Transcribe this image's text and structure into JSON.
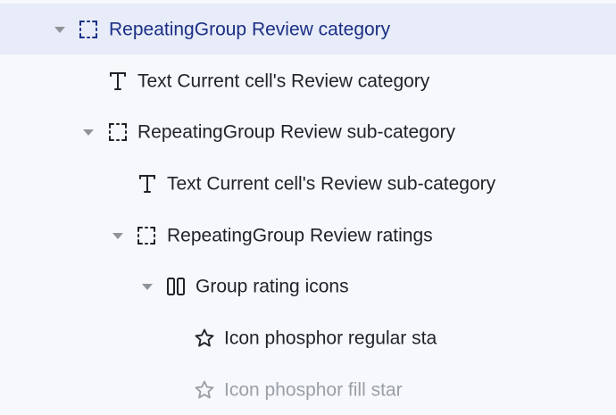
{
  "tree": {
    "items": [
      {
        "label": "RepeatingGroup Review category",
        "icon": "repeating-group-icon",
        "expanded": true,
        "selected": true
      },
      {
        "label": "Text Current cell's Review category",
        "icon": "text-icon"
      },
      {
        "label": "RepeatingGroup Review sub-category",
        "icon": "repeating-group-icon",
        "expanded": true
      },
      {
        "label": "Text Current cell's Review sub-category",
        "icon": "text-icon"
      },
      {
        "label": "RepeatingGroup Review ratings",
        "icon": "repeating-group-icon",
        "expanded": true
      },
      {
        "label": "Group rating icons",
        "icon": "group-icon",
        "expanded": true
      },
      {
        "label": "Icon phosphor regular sta",
        "icon": "star-outline-icon"
      },
      {
        "label": "Icon phosphor fill star",
        "icon": "star-outline-icon",
        "dimmed": true
      }
    ]
  },
  "colors": {
    "background": "#f6f8fc",
    "selected_row": "#e7ecf8",
    "selected_text": "#1c2f86",
    "text": "#1f2328",
    "dimmed_text": "#9aa0a6",
    "caret": "#8f939a"
  }
}
